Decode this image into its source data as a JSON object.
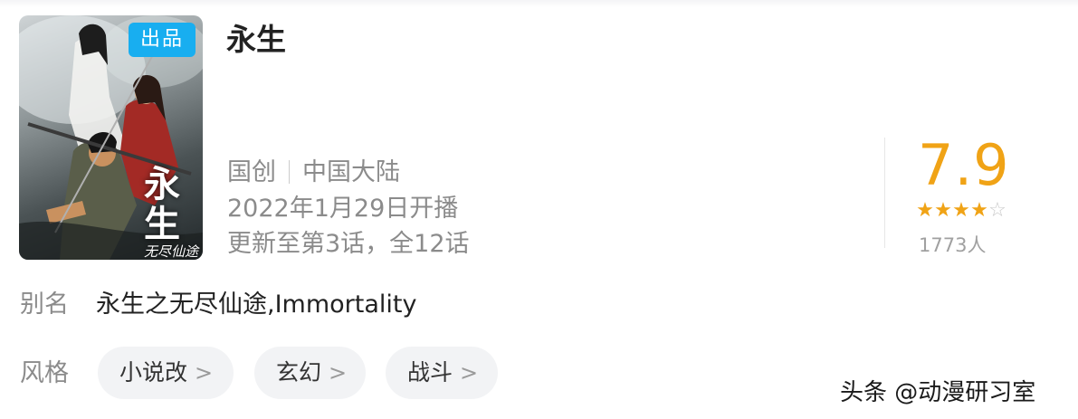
{
  "poster": {
    "badge": "出品",
    "title_art": "永生",
    "subtitle_art": "无尽仙途"
  },
  "title": "永生",
  "meta": {
    "type": "国创",
    "region": "中国大陆",
    "air_date": "2022年1月29日开播",
    "episodes": "更新至第3话，全12话"
  },
  "rating": {
    "score": "7.9",
    "stars_filled": 4,
    "stars_total": 5,
    "count": "1773人",
    "accent_color": "#f0a316"
  },
  "alias": {
    "label": "别名",
    "value": "永生之无尽仙途,Immortality"
  },
  "style": {
    "label": "风格",
    "tags": [
      {
        "label": "小说改",
        "icon": "chevron-right-icon"
      },
      {
        "label": "玄幻",
        "icon": "chevron-right-icon"
      },
      {
        "label": "战斗",
        "icon": "chevron-right-icon"
      }
    ]
  },
  "watermark": "头条 @动漫研习室",
  "colors": {
    "badge": "#18aef0",
    "text_primary": "#222222",
    "text_secondary": "#8b8b8b",
    "tag_bg": "#f2f3f5"
  }
}
